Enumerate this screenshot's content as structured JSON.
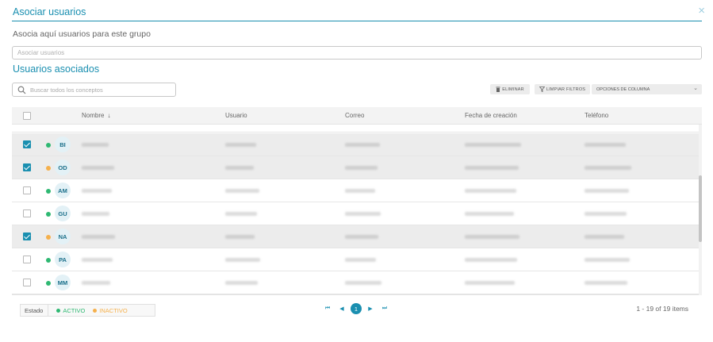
{
  "dialog": {
    "title": "Asociar usuarios",
    "close_icon": "×",
    "subtitle": "Asocia aquí usuarios para este grupo",
    "associate_placeholder": "Asociar usuarios",
    "section_title": "Usuarios asociados"
  },
  "toolbar": {
    "search_placeholder": "Buscar todos los conceptos",
    "delete_label": "ELIMINAR",
    "clear_filters_label": "LIMPIAR FILTROS",
    "column_options_label": "OPCIONES DE COLUMNA"
  },
  "table": {
    "columns": [
      "Nombre",
      "Usuario",
      "Correo",
      "Fecha de creación",
      "Teléfono"
    ],
    "sort_indicator": "↓",
    "rows": [
      {
        "initials": "BI",
        "status": "active",
        "checked": true
      },
      {
        "initials": "OD",
        "status": "inactive",
        "checked": true
      },
      {
        "initials": "AM",
        "status": "active",
        "checked": false
      },
      {
        "initials": "GU",
        "status": "active",
        "checked": false
      },
      {
        "initials": "NA",
        "status": "inactive",
        "checked": true
      },
      {
        "initials": "PA",
        "status": "active",
        "checked": false
      },
      {
        "initials": "MM",
        "status": "active",
        "checked": false
      }
    ]
  },
  "legend": {
    "label": "Estado",
    "active": "ACTIVO",
    "inactive": "INACTIVO"
  },
  "pagination": {
    "first": "⏮",
    "prev": "◀",
    "current": "1",
    "next": "▶",
    "last": "⏭",
    "info": "1 - 19 of 19 items"
  },
  "colors": {
    "accent": "#1a8fb0",
    "active": "#2eb872",
    "inactive": "#f5b04c",
    "selected_row": "#ececec"
  }
}
